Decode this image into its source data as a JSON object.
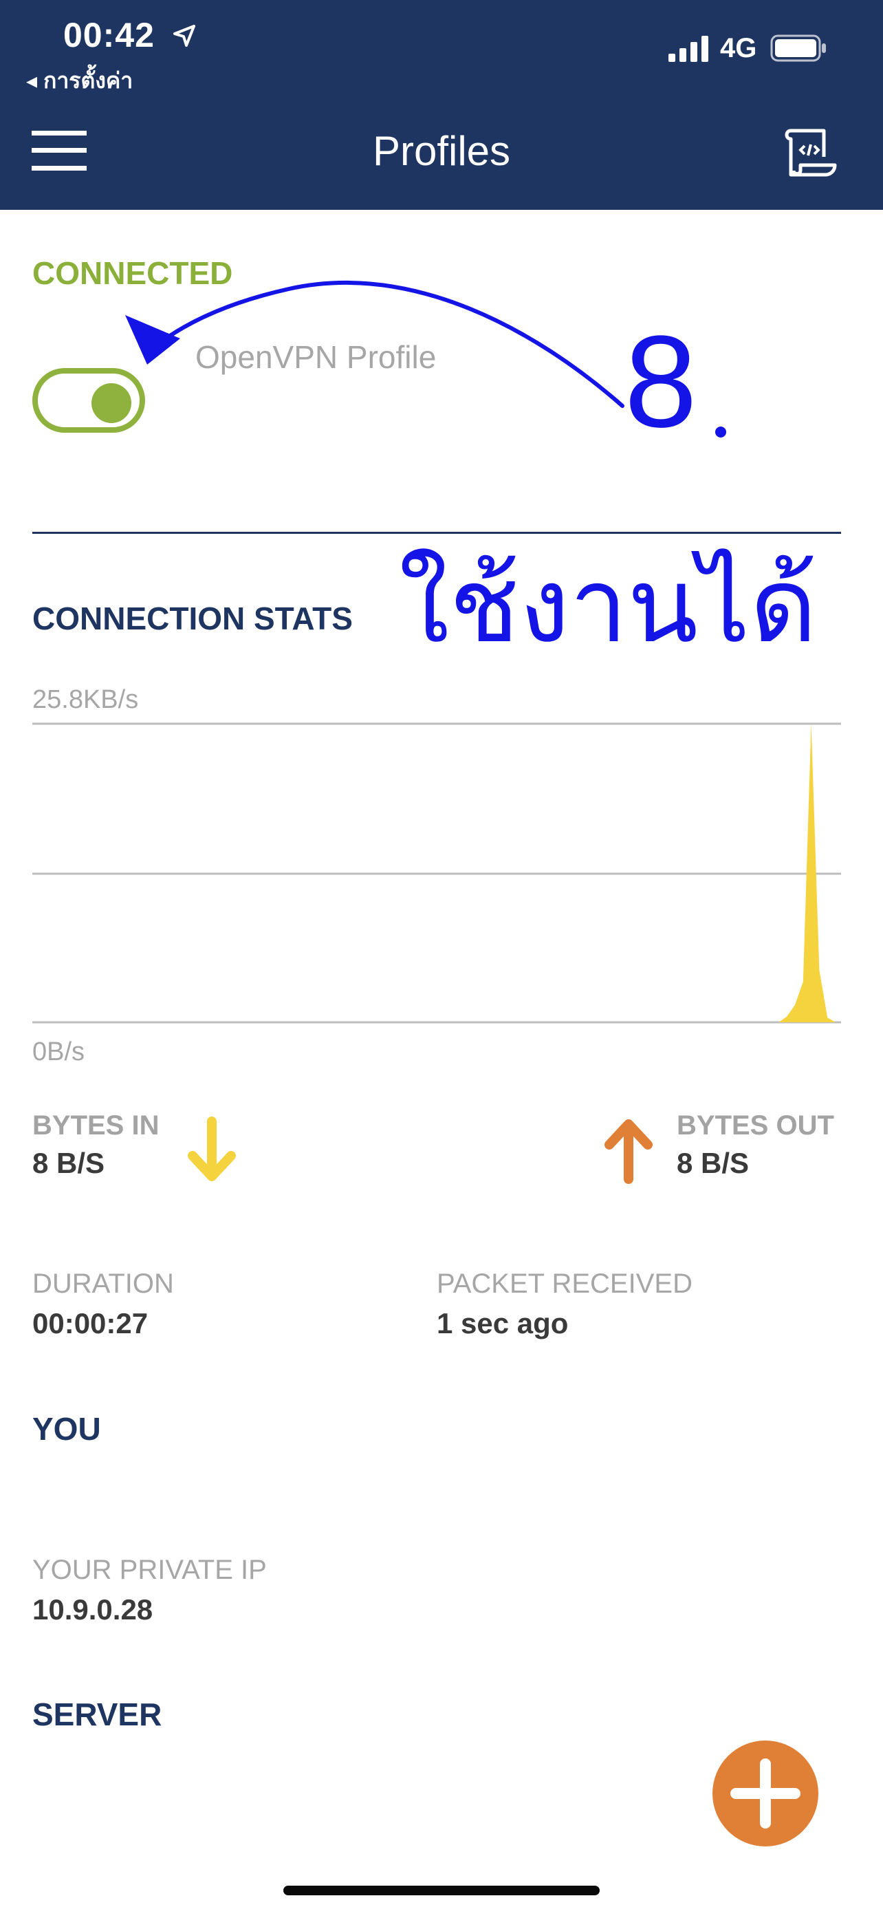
{
  "status_bar": {
    "time": "00:42",
    "back_label": "◂ การตั้งค่า",
    "network": "4G"
  },
  "header": {
    "title": "Profiles",
    "menu_icon": "hamburger-menu-icon",
    "import_icon": "import-profile-icon"
  },
  "profile": {
    "state": "CONNECTED",
    "name": "OpenVPN Profile",
    "toggle_on": true,
    "state_color": "#8bb03a"
  },
  "stats": {
    "title": "CONNECTION STATS",
    "y_max_label": "25.8KB/s",
    "y_min_label": "0B/s",
    "bytes_in_label": "BYTES IN",
    "bytes_in_value": "8 B/S",
    "bytes_out_label": "BYTES OUT",
    "bytes_out_value": "8 B/S",
    "duration_label": "DURATION",
    "duration_value": "00:00:27",
    "packet_label": "PACKET RECEIVED",
    "packet_value": "1 sec ago",
    "in_color": "#f5d33f",
    "out_color": "#e07f36"
  },
  "you": {
    "title": "YOU",
    "private_ip_label": "YOUR PRIVATE IP",
    "private_ip_value": "10.9.0.28"
  },
  "server": {
    "title": "SERVER"
  },
  "annotation": {
    "number": "8",
    "text": "ใช้งานได้"
  },
  "colors": {
    "header": "#1f3561",
    "accent_green": "#8fb23e",
    "fab": "#e07f36",
    "annotation": "#1414e6"
  },
  "chart_data": {
    "type": "area",
    "y_max_label": "25.8KB/s",
    "y_min_label": "0B/s",
    "ylim": [
      0,
      25.8
    ],
    "grid": true,
    "series": [
      {
        "values": [
          0,
          0,
          0,
          0,
          0,
          0,
          0,
          0,
          0,
          0,
          0,
          0,
          0,
          0,
          0,
          0,
          0,
          0,
          0,
          0,
          0,
          0,
          0,
          0,
          0,
          0,
          0,
          0,
          0,
          0,
          0,
          0,
          0,
          0,
          0,
          0,
          0,
          0,
          0,
          0,
          0,
          0,
          0,
          0,
          0,
          0,
          0,
          0,
          0,
          0,
          0,
          0,
          0,
          0,
          0,
          0,
          0,
          0,
          0,
          0,
          0,
          0,
          0,
          0,
          0,
          0,
          0,
          0,
          0,
          0,
          0,
          0,
          0,
          0,
          0,
          0,
          0,
          0,
          0,
          0,
          0,
          0,
          0,
          0,
          0,
          0,
          0,
          0,
          0,
          0,
          0,
          0,
          0,
          0.5,
          1.5,
          3.5,
          25.8,
          4.5,
          0.4,
          0
        ]
      }
    ]
  }
}
